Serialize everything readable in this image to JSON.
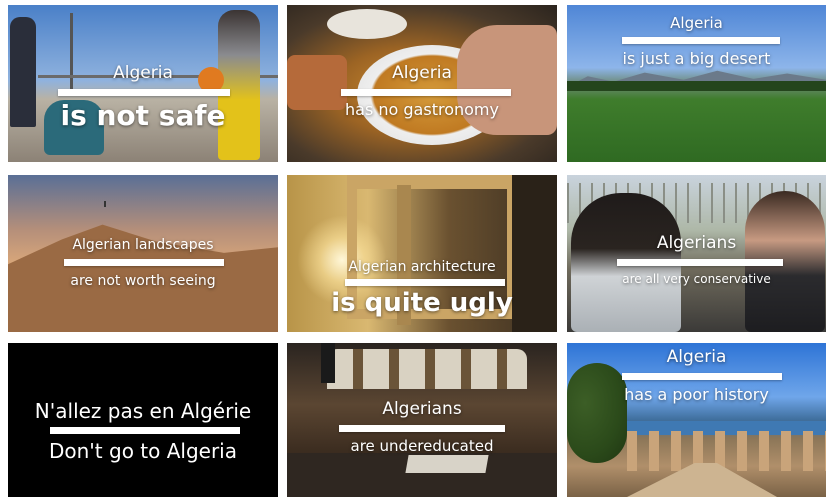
{
  "tiles": [
    {
      "line1": "Algeria",
      "line2": "is not safe"
    },
    {
      "line1": "Algeria",
      "line2": "has no gastronomy"
    },
    {
      "line1": "Algeria",
      "line2": "is just a big desert"
    },
    {
      "line1": "Algerian landscapes",
      "line2": "are not worth seeing"
    },
    {
      "line1": "Algerian architecture",
      "line2": "is quite ugly"
    },
    {
      "line1": "Algerians",
      "line2": "are all very conservative"
    },
    {
      "line1": "N'allez pas en Algérie",
      "line2": "Don't go to Algeria"
    },
    {
      "line1": "Algerians",
      "line2": "are undereducated"
    },
    {
      "line1": "Algeria",
      "line2": "has a poor history"
    }
  ]
}
